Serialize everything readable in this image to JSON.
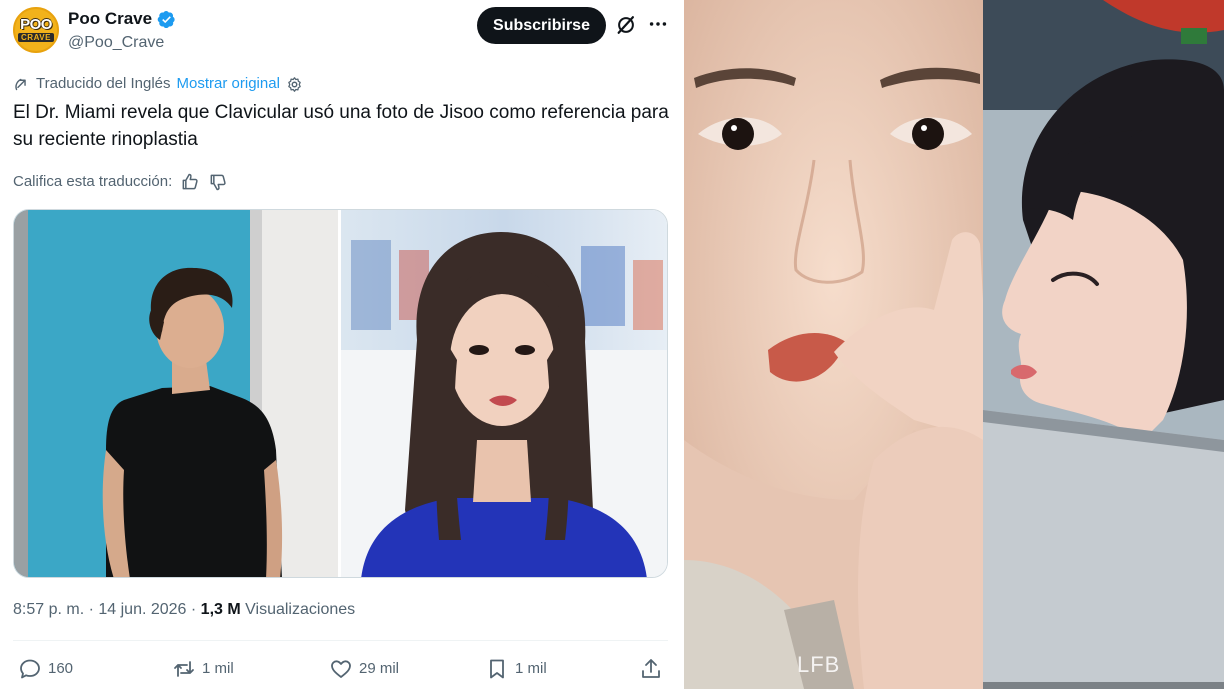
{
  "account": {
    "name": "Poo Crave",
    "handle": "@Poo_Crave",
    "avatar_line1": "POO",
    "avatar_line2": "CRAVE",
    "verified_icon": "verified-badge-icon",
    "avatar_color": "#f2b21b"
  },
  "header": {
    "subscribe_label": "Subscribirse"
  },
  "translation": {
    "translated_label": "Traducido del Inglés",
    "show_original_label": "Mostrar original",
    "rate_label": "Califica esta traducción:"
  },
  "tweet": {
    "text": "El Dr. Miami revela que Clavicular usó una foto de Jisoo como referencia para su reciente rinoplastia",
    "time": "8:57 p. m.",
    "separator": " · ",
    "date": "14 jun. 2026",
    "views_count": "1,3 M",
    "views_label": "Visualizaciones"
  },
  "actions": {
    "replies": "160",
    "reposts": "1 mil",
    "likes": "29 mil",
    "bookmarks": "1 mil"
  },
  "photos": {
    "watermark": "LFB"
  },
  "colors": {
    "accent": "#1d9bf0",
    "text_primary": "#0f1419",
    "text_secondary": "#536471",
    "subscribe_bg": "#0f1419"
  }
}
